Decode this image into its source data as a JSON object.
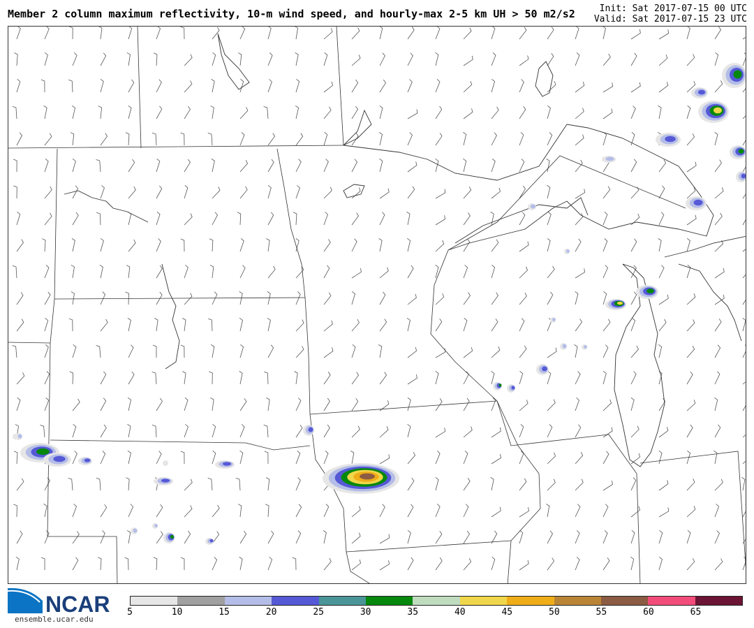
{
  "title": "Member 2 column maximum reflectivity, 10-m wind speed, and hourly-max 2-5 km UH > 50 m2/s2",
  "init_time": "Init: Sat 2017-07-15 00 UTC",
  "valid_time": "Valid: Sat 2017-07-15 23 UTC",
  "logo": {
    "text": "NCAR",
    "url": "ensemble.ucar.edu",
    "icon": "ncar-swoosh-logo"
  },
  "colorbar": {
    "labels": [
      "5",
      "10",
      "15",
      "20",
      "25",
      "30",
      "35",
      "40",
      "45",
      "50",
      "55",
      "60",
      "65"
    ],
    "colors": [
      "#e6e6e6",
      "#a0a0a0",
      "#b4bde8",
      "#5559d6",
      "#4a9598",
      "#05880b",
      "#bfdcbf",
      "#f0d64a",
      "#efad18",
      "#b98535",
      "#8b5b43",
      "#f24c7a",
      "#6b1433"
    ]
  },
  "wind_barb_color": "#555555",
  "boundary_color": "#333333"
}
